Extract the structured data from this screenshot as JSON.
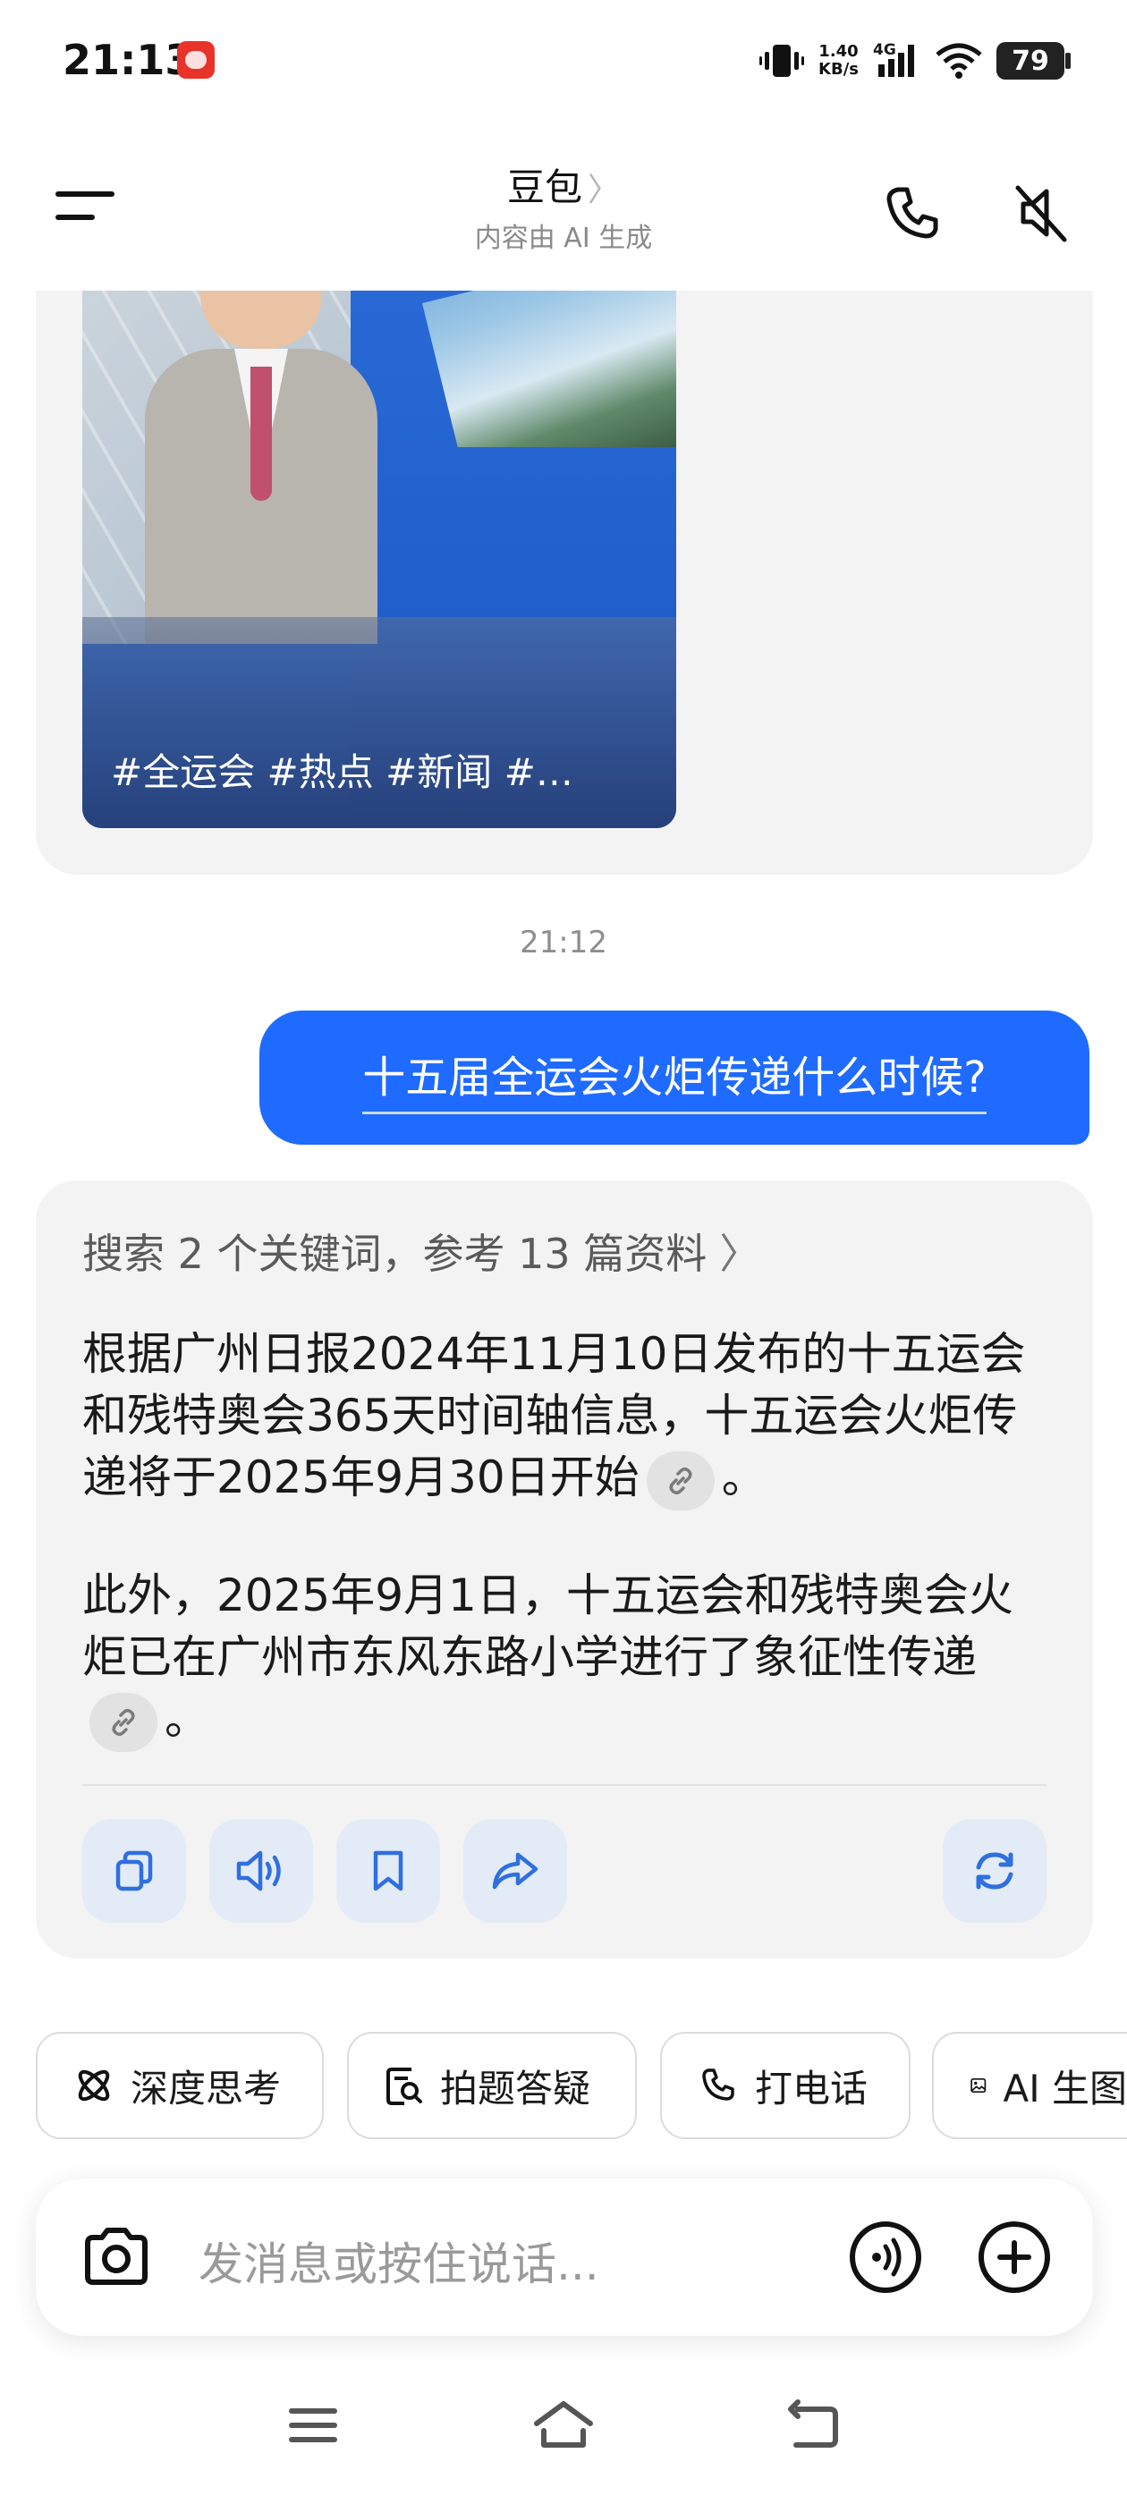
{
  "status_bar": {
    "time": "21:13",
    "net_speed_value": "1.40",
    "net_speed_unit": "KB/s",
    "network_type": "4G",
    "battery": "79"
  },
  "header": {
    "title": "豆包",
    "title_chevron": "〉",
    "subtitle": "内容由 AI 生成"
  },
  "video_card": {
    "tags": "#全运会 #热点 #新闻 #…"
  },
  "chat": {
    "timestamp": "21:12",
    "user_message": "十五届全运会火炬传递什么时候?",
    "answer": {
      "search_summary": "搜索 2 个关键词，参考 13 篇资料",
      "search_chevron": "〉",
      "paragraph1": "根据广州日报2024年11月10日发布的十五运会和残特奥会365天时间轴信息，十五运会火炬传递将于2025年9月30日开始",
      "paragraph2": "此外，2025年9月1日，十五运会和残特奥会火炬已在广州市东风东路小学进行了象征性传递",
      "period": "。"
    }
  },
  "quick_actions": [
    {
      "label": "深度思考",
      "icon": "atom-icon"
    },
    {
      "label": "拍题答疑",
      "icon": "scan-document-icon"
    },
    {
      "label": "打电话",
      "icon": "phone-icon"
    },
    {
      "label": "AI 生图",
      "icon": "image-icon"
    }
  ],
  "input": {
    "placeholder": "发消息或按住说话..."
  },
  "colors": {
    "accent_blue": "#1f6bff",
    "bubble_gray": "#f3f3f3",
    "action_button_bg": "#e3ebf7",
    "action_icon": "#2f6fe0"
  }
}
